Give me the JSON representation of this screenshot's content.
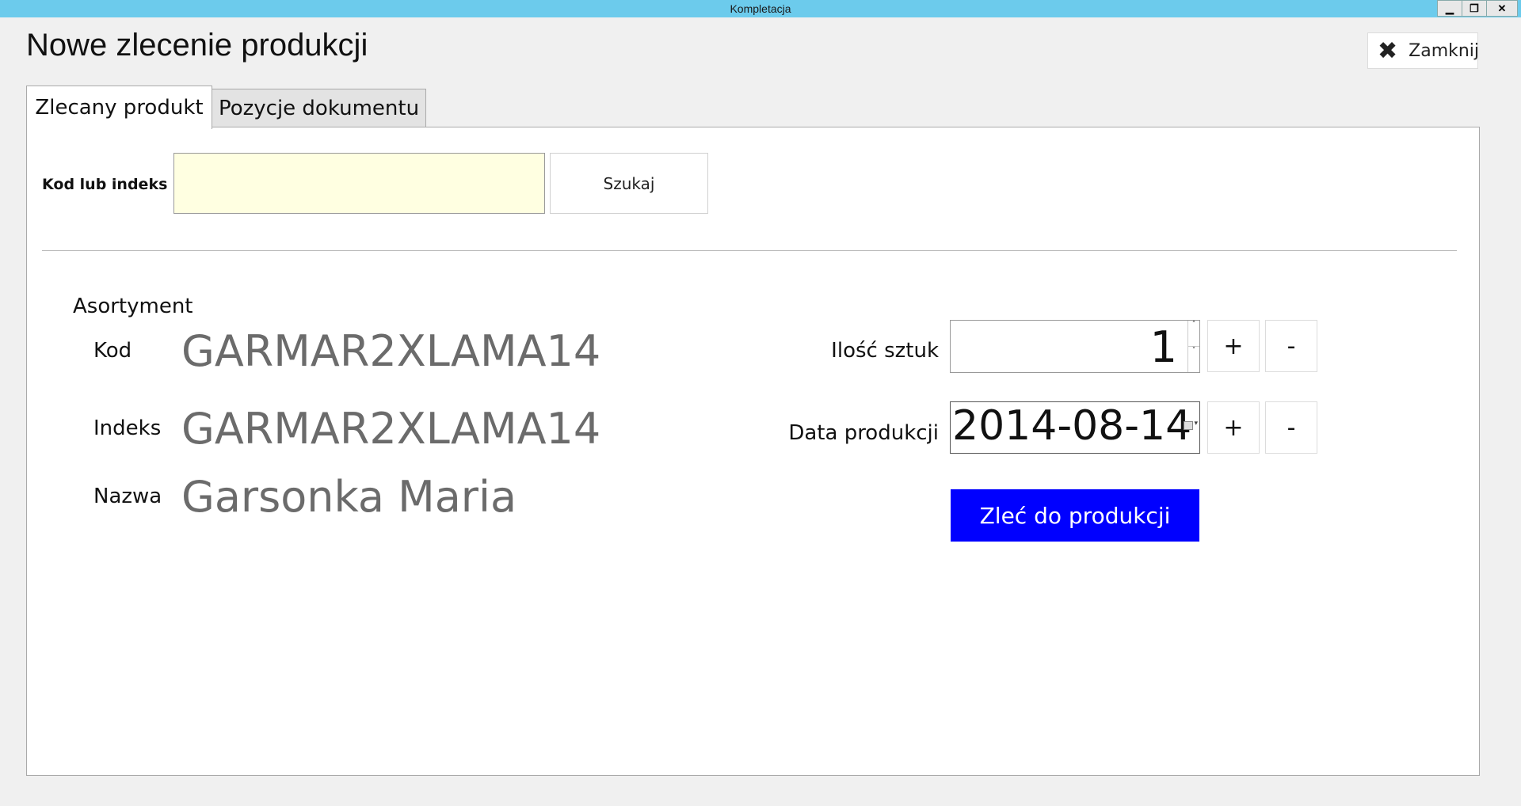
{
  "window": {
    "title": "Kompletacja",
    "minimize_glyph": "▁",
    "restore_glyph": "❐",
    "close_glyph": "✕"
  },
  "header": {
    "title": "Nowe zlecenie produkcji",
    "close_label": "Zamknij",
    "close_icon": "✖"
  },
  "tabs": [
    {
      "label": "Zlecany produkt",
      "active": true
    },
    {
      "label": "Pozycje dokumentu",
      "active": false
    }
  ],
  "search": {
    "label": "Kod lub indeks",
    "value": "",
    "button_label": "Szukaj"
  },
  "assortment": {
    "section_label": "Asortyment",
    "code_label": "Kod",
    "code_value": "GARMAR2XLAMA14",
    "index_label": "Indeks",
    "index_value": "GARMAR2XLAMA14",
    "name_label": "Nazwa",
    "name_value": "Garsonka Maria"
  },
  "order": {
    "quantity_label": "Ilość sztuk",
    "quantity_value": "1",
    "spin_up": "˄",
    "spin_down": "˅",
    "date_label": "Data produkcji",
    "date_value": "2014-08-14",
    "date_caret": "▾",
    "plus_label": "+",
    "minus_label": "-",
    "submit_label": "Zleć do produkcji",
    "submit_color": "#0000ff"
  }
}
